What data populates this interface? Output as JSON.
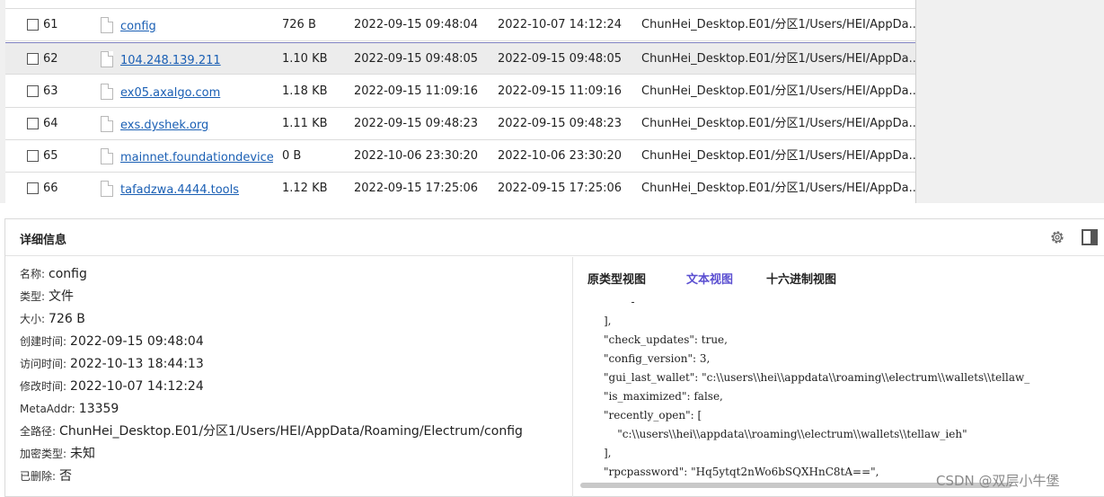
{
  "table": {
    "rows": [
      {
        "index": "61",
        "name": "config",
        "size": "726 B",
        "created": "2022-09-15 09:48:04",
        "modified": "2022-10-07 14:12:24",
        "path": "ChunHei_Desktop.E01/分区1/Users/HEI/AppDa..."
      },
      {
        "index": "62",
        "name": "104.248.139.211",
        "size": "1.10 KB",
        "created": "2022-09-15 09:48:05",
        "modified": "2022-09-15 09:48:05",
        "path": "ChunHei_Desktop.E01/分区1/Users/HEI/AppDa..."
      },
      {
        "index": "63",
        "name": "ex05.axalgo.com",
        "size": "1.18 KB",
        "created": "2022-09-15 11:09:16",
        "modified": "2022-09-15 11:09:16",
        "path": "ChunHei_Desktop.E01/分区1/Users/HEI/AppDa..."
      },
      {
        "index": "64",
        "name": "exs.dyshek.org",
        "size": "1.11 KB",
        "created": "2022-09-15 09:48:23",
        "modified": "2022-09-15 09:48:23",
        "path": "ChunHei_Desktop.E01/分区1/Users/HEI/AppDa..."
      },
      {
        "index": "65",
        "name": "mainnet.foundationdevices.",
        "size": "0 B",
        "created": "2022-10-06 23:30:20",
        "modified": "2022-10-06 23:30:20",
        "path": "ChunHei_Desktop.E01/分区1/Users/HEI/AppDa..."
      },
      {
        "index": "66",
        "name": "tafadzwa.4444.tools",
        "size": "1.12 KB",
        "created": "2022-09-15 17:25:06",
        "modified": "2022-09-15 17:25:06",
        "path": "ChunHei_Desktop.E01/分区1/Users/HEI/AppDa..."
      }
    ]
  },
  "details": {
    "title": "详细信息",
    "props": [
      {
        "label": "名称:",
        "value": "config"
      },
      {
        "label": "类型:",
        "value": "文件"
      },
      {
        "label": "大小:",
        "value": "726 B"
      },
      {
        "label": "创建时间:",
        "value": "2022-09-15 09:48:04"
      },
      {
        "label": "访问时间:",
        "value": "2022-10-13 18:44:13"
      },
      {
        "label": "修改时间:",
        "value": "2022-10-07 14:12:24"
      },
      {
        "label": "MetaAddr:",
        "value": "13359"
      },
      {
        "label": "全路径:",
        "value": "ChunHei_Desktop.E01/分区1/Users/HEI/AppData/Roaming/Electrum/config"
      },
      {
        "label": "加密类型:",
        "value": "未知"
      },
      {
        "label": "已删除:",
        "value": "否"
      }
    ],
    "tabs": [
      {
        "label": "原类型视图"
      },
      {
        "label": "文本视图"
      },
      {
        "label": "十六进制视图"
      }
    ],
    "text_view_lines": [
      "        -",
      "],",
      "\"check_updates\": true,",
      "\"config_version\": 3,",
      "\"gui_last_wallet\": \"c:\\\\users\\\\hei\\\\appdata\\\\roaming\\\\electrum\\\\wallets\\\\tellaw_",
      "\"is_maximized\": false,",
      "\"recently_open\": [",
      "    \"c:\\\\users\\\\hei\\\\appdata\\\\roaming\\\\electrum\\\\wallets\\\\tellaw_ieh\"",
      "],",
      "\"rpcpassword\": \"Hq5ytqt2nWo6bSQXHnC8tA==\","
    ]
  },
  "watermark": "CSDN @双层小牛堡"
}
